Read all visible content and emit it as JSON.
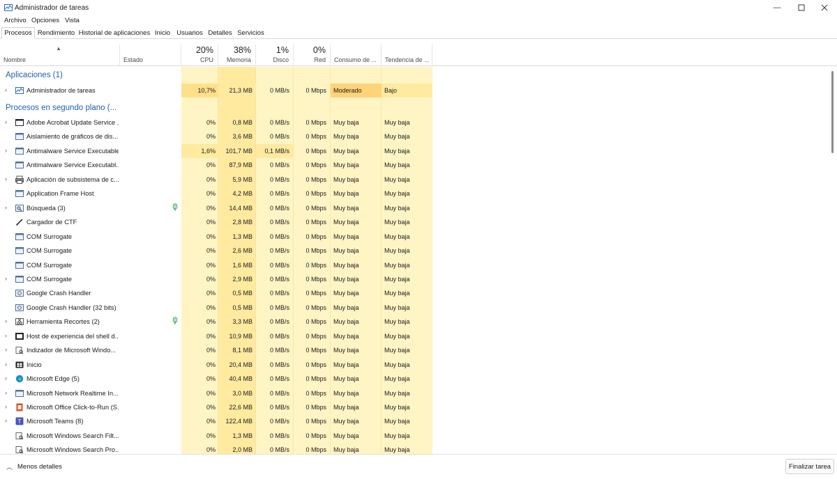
{
  "window": {
    "title": "Administrador de tareas"
  },
  "menu": [
    "Archivo",
    "Opciones",
    "Vista"
  ],
  "tabs": [
    "Procesos",
    "Rendimiento",
    "Historial de aplicaciones",
    "Inicio",
    "Usuarios",
    "Detalles",
    "Servicios"
  ],
  "columns": {
    "nombre": "Nombre",
    "estado": "Estado",
    "cpu": {
      "pct": "20%",
      "label": "CPU"
    },
    "memoria": {
      "pct": "38%",
      "label": "Memoria"
    },
    "disco": {
      "pct": "1%",
      "label": "Disco"
    },
    "red": {
      "pct": "0%",
      "label": "Red"
    },
    "consumo": "Consumo de ...",
    "tendencia": "Tendencia de ..."
  },
  "groups": {
    "apps": "Aplicaciones (1)",
    "background": "Procesos en segundo plano (..."
  },
  "app_rows": [
    {
      "name": "Administrador de tareas",
      "cpu": "10,7%",
      "mem": "21,3 MB",
      "disk": "0 MB/s",
      "net": "0 Mbps",
      "consumo": "Moderado",
      "tendencia": "Bajo",
      "icon": "task-manager-icon",
      "expand": true
    }
  ],
  "bg_rows": [
    {
      "name": "Adobe Acrobat Update Service ...",
      "cpu": "0%",
      "mem": "0,8 MB",
      "disk": "0 MB/s",
      "net": "0 Mbps",
      "consumo": "Muy baja",
      "tendencia": "Muy baja",
      "icon": "service-window-icon",
      "expand": true
    },
    {
      "name": "Aislamiento de gráficos de dis...",
      "cpu": "0%",
      "mem": "3,6 MB",
      "disk": "0 MB/s",
      "net": "0 Mbps",
      "consumo": "Muy baja",
      "tendencia": "Muy baja",
      "icon": "app-window-icon",
      "expand": false
    },
    {
      "name": "Antimalware Service Executable",
      "cpu": "1,6%",
      "mem": "101,7 MB",
      "disk": "0,1 MB/s",
      "net": "0 Mbps",
      "consumo": "Muy baja",
      "tendencia": "Muy baja",
      "icon": "app-window-icon",
      "expand": true
    },
    {
      "name": "Antimalware Service Executabl...",
      "cpu": "0%",
      "mem": "87,9 MB",
      "disk": "0 MB/s",
      "net": "0 Mbps",
      "consumo": "Muy baja",
      "tendencia": "Muy baja",
      "icon": "app-window-icon",
      "expand": false
    },
    {
      "name": "Aplicación de subsistema de c...",
      "cpu": "0%",
      "mem": "5,9 MB",
      "disk": "0 MB/s",
      "net": "0 Mbps",
      "consumo": "Muy baja",
      "tendencia": "Muy baja",
      "icon": "printer-icon",
      "expand": true
    },
    {
      "name": "Application Frame Host",
      "cpu": "0%",
      "mem": "4,2 MB",
      "disk": "0 MB/s",
      "net": "0 Mbps",
      "consumo": "Muy baja",
      "tendencia": "Muy baja",
      "icon": "app-window-icon",
      "expand": false
    },
    {
      "name": "Búsqueda (3)",
      "cpu": "0%",
      "mem": "14,4 MB",
      "disk": "0 MB/s",
      "net": "0 Mbps",
      "consumo": "Muy baja",
      "tendencia": "Muy baja",
      "icon": "search-icon",
      "expand": true,
      "leaf": true
    },
    {
      "name": "Cargador de CTF",
      "cpu": "0%",
      "mem": "2,8 MB",
      "disk": "0 MB/s",
      "net": "0 Mbps",
      "consumo": "Muy baja",
      "tendencia": "Muy baja",
      "icon": "pen-icon",
      "expand": false
    },
    {
      "name": "COM Surrogate",
      "cpu": "0%",
      "mem": "1,3 MB",
      "disk": "0 MB/s",
      "net": "0 Mbps",
      "consumo": "Muy baja",
      "tendencia": "Muy baja",
      "icon": "app-window-icon",
      "expand": false
    },
    {
      "name": "COM Surrogate",
      "cpu": "0%",
      "mem": "2,6 MB",
      "disk": "0 MB/s",
      "net": "0 Mbps",
      "consumo": "Muy baja",
      "tendencia": "Muy baja",
      "icon": "app-window-icon",
      "expand": false
    },
    {
      "name": "COM Surrogate",
      "cpu": "0%",
      "mem": "1,6 MB",
      "disk": "0 MB/s",
      "net": "0 Mbps",
      "consumo": "Muy baja",
      "tendencia": "Muy baja",
      "icon": "app-window-icon",
      "expand": false
    },
    {
      "name": "COM Surrogate",
      "cpu": "0%",
      "mem": "2,9 MB",
      "disk": "0 MB/s",
      "net": "0 Mbps",
      "consumo": "Muy baja",
      "tendencia": "Muy baja",
      "icon": "app-window-icon",
      "expand": true
    },
    {
      "name": "Google Crash Handler",
      "cpu": "0%",
      "mem": "0,5 MB",
      "disk": "0 MB/s",
      "net": "0 Mbps",
      "consumo": "Muy baja",
      "tendencia": "Muy baja",
      "icon": "gear-icon",
      "expand": false
    },
    {
      "name": "Google Crash Handler (32 bits)",
      "cpu": "0%",
      "mem": "0,5 MB",
      "disk": "0 MB/s",
      "net": "0 Mbps",
      "consumo": "Muy baja",
      "tendencia": "Muy baja",
      "icon": "gear-icon",
      "expand": false
    },
    {
      "name": "Herramienta Recortes (2)",
      "cpu": "0%",
      "mem": "3,3 MB",
      "disk": "0 MB/s",
      "net": "0 Mbps",
      "consumo": "Muy baja",
      "tendencia": "Muy baja",
      "icon": "snipping-icon",
      "expand": true,
      "leaf": true
    },
    {
      "name": "Host de experiencia del shell d...",
      "cpu": "0%",
      "mem": "10,9 MB",
      "disk": "0 MB/s",
      "net": "0 Mbps",
      "consumo": "Muy baja",
      "tendencia": "Muy baja",
      "icon": "shell-icon",
      "expand": true
    },
    {
      "name": "Indizador de Microsoft Windo...",
      "cpu": "0%",
      "mem": "8,1 MB",
      "disk": "0 MB/s",
      "net": "0 Mbps",
      "consumo": "Muy baja",
      "tendencia": "Muy baja",
      "icon": "indexer-icon",
      "expand": true
    },
    {
      "name": "Inicio",
      "cpu": "0%",
      "mem": "20,4 MB",
      "disk": "0 MB/s",
      "net": "0 Mbps",
      "consumo": "Muy baja",
      "tendencia": "Muy baja",
      "icon": "start-icon",
      "expand": true
    },
    {
      "name": "Microsoft Edge (5)",
      "cpu": "0%",
      "mem": "40,4 MB",
      "disk": "0 MB/s",
      "net": "0 Mbps",
      "consumo": "Muy baja",
      "tendencia": "Muy baja",
      "icon": "edge-icon",
      "expand": true
    },
    {
      "name": "Microsoft Network Realtime In...",
      "cpu": "0%",
      "mem": "3,0 MB",
      "disk": "0 MB/s",
      "net": "0 Mbps",
      "consumo": "Muy baja",
      "tendencia": "Muy baja",
      "icon": "app-window-icon",
      "expand": true
    },
    {
      "name": "Microsoft Office Click-to-Run (S...",
      "cpu": "0%",
      "mem": "22,6 MB",
      "disk": "0 MB/s",
      "net": "0 Mbps",
      "consumo": "Muy baja",
      "tendencia": "Muy baja",
      "icon": "office-icon",
      "expand": true
    },
    {
      "name": "Microsoft Teams (8)",
      "cpu": "0%",
      "mem": "122,4 MB",
      "disk": "0 MB/s",
      "net": "0 Mbps",
      "consumo": "Muy baja",
      "tendencia": "Muy baja",
      "icon": "teams-icon",
      "expand": true
    },
    {
      "name": "Microsoft Windows Search Filt...",
      "cpu": "0%",
      "mem": "1,3 MB",
      "disk": "0 MB/s",
      "net": "0 Mbps",
      "consumo": "Muy baja",
      "tendencia": "Muy baja",
      "icon": "indexer-icon",
      "expand": false
    },
    {
      "name": "Microsoft Windows Search Pro...",
      "cpu": "0%",
      "mem": "2,0 MB",
      "disk": "0 MB/s",
      "net": "0 Mbps",
      "consumo": "Muy baja",
      "tendencia": "Muy baja",
      "icon": "indexer-icon",
      "expand": false
    }
  ],
  "footer": {
    "less": "Menos detalles",
    "end_task": "Finalizar tarea"
  },
  "colors": {
    "heat_light": "#fff4c4",
    "heat_mid": "#ffeaa0",
    "heat_strong": "#ffe08a",
    "heat_high": "#ffd378",
    "group_blue": "#1f5fb4",
    "leaf_green": "#2c9c4a"
  }
}
